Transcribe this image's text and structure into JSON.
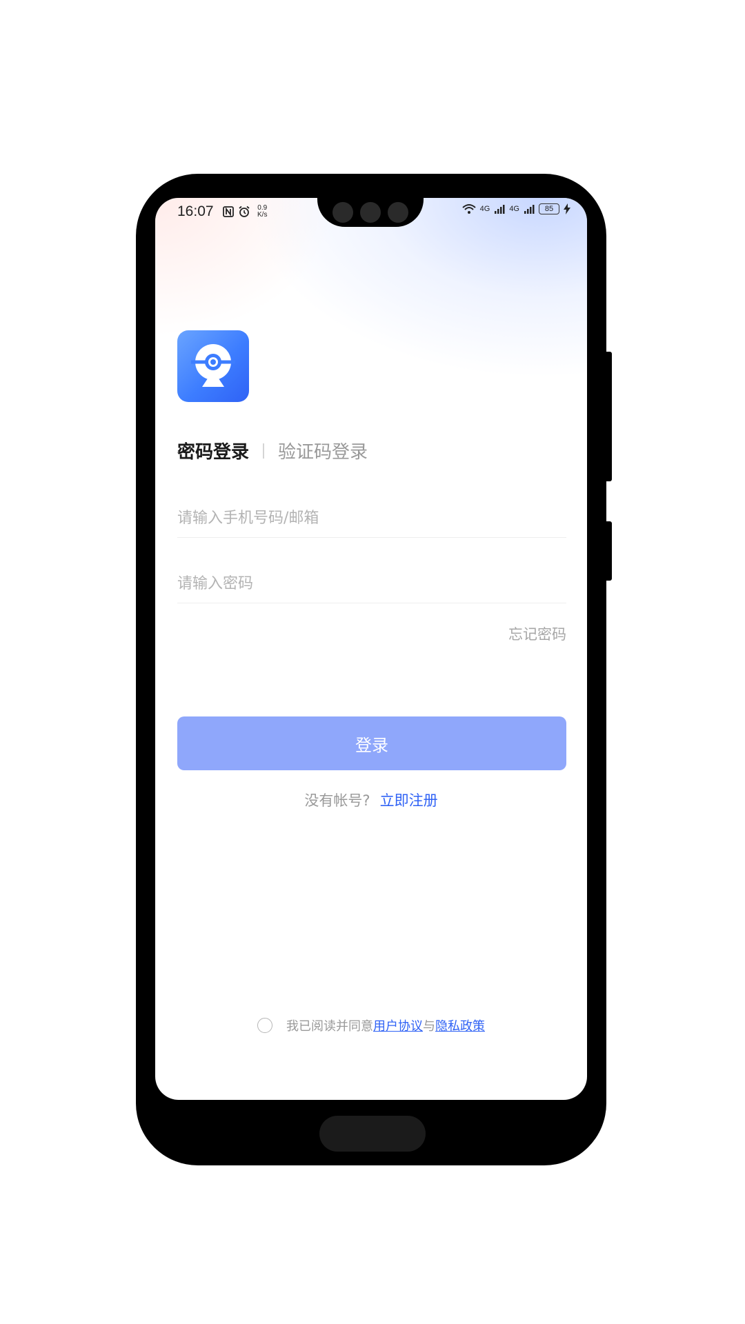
{
  "status_bar": {
    "time": "16:07",
    "speed_value": "0.9",
    "speed_unit": "K/s",
    "net_1": "4G",
    "net_2": "4G",
    "battery": "85",
    "icons_left": [
      "nfc-icon",
      "alarm-icon"
    ],
    "icons_right": [
      "wifi-icon",
      "signal-icon",
      "signal-icon",
      "battery-icon",
      "charging-icon"
    ]
  },
  "app": {
    "logo": "webcam-app-icon"
  },
  "tabs": {
    "password_login": "密码登录",
    "code_login": "验证码登录"
  },
  "form": {
    "account_placeholder": "请输入手机号码/邮箱",
    "password_placeholder": "请输入密码",
    "forgot_password": "忘记密码",
    "login_button": "登录"
  },
  "register": {
    "question": "没有帐号?",
    "link": "立即注册"
  },
  "agreement": {
    "prefix": "我已阅读并同意",
    "user_agreement": "用户协议",
    "conjunction": "与",
    "privacy_policy": "隐私政策"
  },
  "colors": {
    "accent": "#2f62f5",
    "login_button_bg": "#8fa7fb",
    "hint_text": "#b3b3b3"
  }
}
